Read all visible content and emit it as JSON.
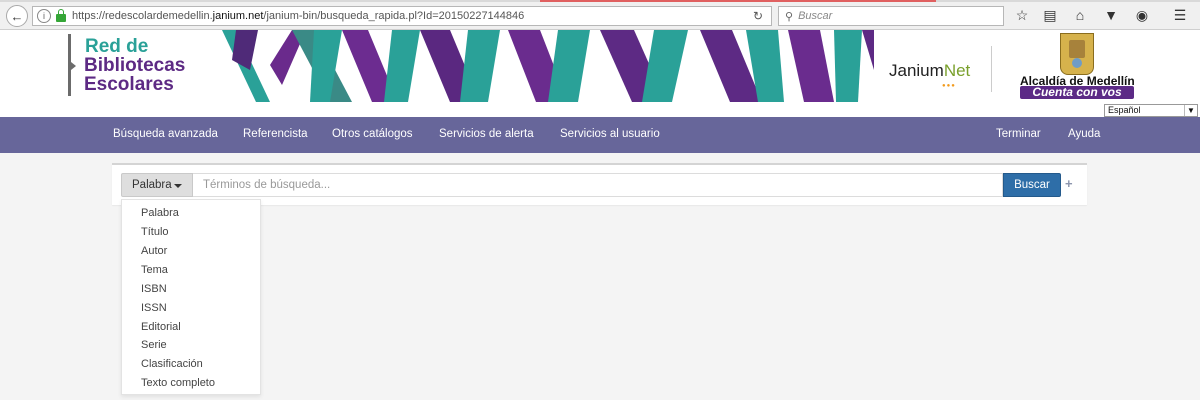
{
  "browser": {
    "url_prefix": "https://redescolardemedellin.",
    "url_domain": "janium.net",
    "url_suffix": "/janium-bin/busqueda_rapida.pl?Id=20150227144846",
    "search_placeholder": "Buscar"
  },
  "header": {
    "logo_line1": "Red de",
    "logo_line2": "Bibliotecas",
    "logo_line3": "Escolares",
    "janium_text": "Janium",
    "janium_accent": "Net",
    "alcaldia": "Alcaldía de Medellín",
    "cuenta": "Cuenta con vos",
    "language": "Español"
  },
  "nav": {
    "items": [
      "Búsqueda avanzada",
      "Referencista",
      "Otros catálogos",
      "Servicios de alerta",
      "Servicios al usuario"
    ],
    "right": [
      "Terminar",
      "Ayuda"
    ]
  },
  "search": {
    "field_label": "Palabra",
    "placeholder": "Términos de búsqueda...",
    "button": "Buscar",
    "plus": "+"
  },
  "dropdown": {
    "options": [
      "Palabra",
      "Título",
      "Autor",
      "Tema",
      "ISBN",
      "ISSN",
      "Editorial",
      "Serie",
      "Clasificación",
      "Texto completo"
    ]
  },
  "colors": {
    "nav_bg": "#67669a",
    "teal": "#2aa198",
    "purple": "#5d2a84",
    "button_blue": "#2e6ea8"
  }
}
